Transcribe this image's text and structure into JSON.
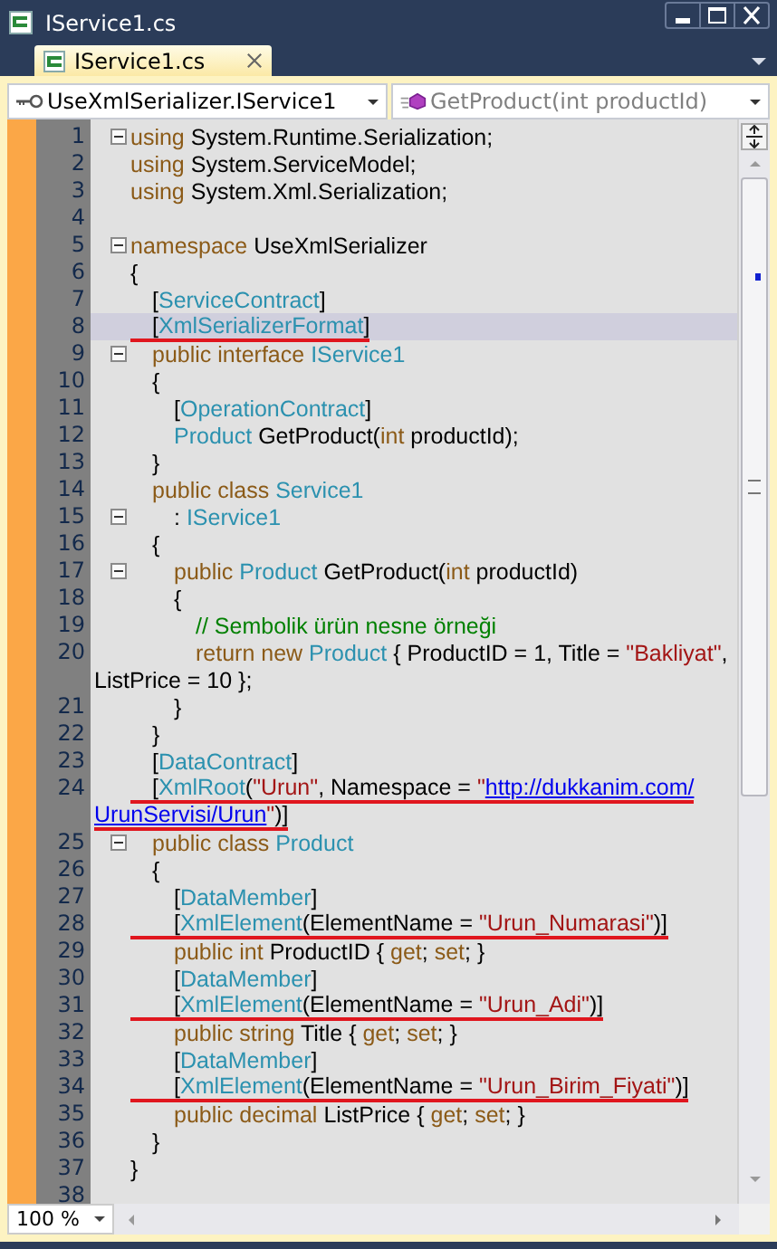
{
  "window": {
    "title": "IService1.cs"
  },
  "tabs": [
    {
      "label": "IService1.cs",
      "selected": true
    }
  ],
  "navigation": {
    "type_combo": "UseXmlSerializer.IService1",
    "member_combo": "GetProduct(int productId)"
  },
  "editor": {
    "lines": [
      {
        "number": "1",
        "fold": true,
        "tokens": [
          {
            "kind": "keyword",
            "text": "using"
          },
          {
            "kind": "plain",
            "text": " System.Runtime.Serialization;"
          }
        ]
      },
      {
        "number": "2",
        "fold": false,
        "tokens": [
          {
            "kind": "keyword",
            "text": "using"
          },
          {
            "kind": "plain",
            "text": " System.ServiceModel;"
          }
        ]
      },
      {
        "number": "3",
        "fold": false,
        "tokens": [
          {
            "kind": "keyword",
            "text": "using"
          },
          {
            "kind": "plain",
            "text": " System.Xml.Serialization;"
          }
        ]
      },
      {
        "number": "4",
        "fold": false
      },
      {
        "number": "5",
        "fold": true,
        "tokens": [
          {
            "kind": "keyword",
            "text": "namespace"
          },
          {
            "kind": "plain",
            "text": " UseXmlSerializer"
          }
        ]
      },
      {
        "number": "6",
        "fold": false,
        "tokens": [
          {
            "kind": "plain",
            "text": "{"
          }
        ]
      },
      {
        "number": "7",
        "fold": false,
        "tokens": [
          {
            "kind": "plain",
            "text": "\t["
          },
          {
            "kind": "type",
            "text": "ServiceContract"
          },
          {
            "kind": "plain",
            "text": "]"
          }
        ]
      },
      {
        "number": "8",
        "fold": false,
        "current": true,
        "underlined": true,
        "tokens": [
          {
            "kind": "plain",
            "text": "\t["
          },
          {
            "kind": "type",
            "text": "XmlSerializerFormat"
          },
          {
            "kind": "plain",
            "text": "]"
          }
        ]
      },
      {
        "number": "9",
        "fold": true,
        "tokens": [
          {
            "kind": "keyword",
            "text": "\tpublic interface "
          },
          {
            "kind": "type",
            "text": "IService1"
          }
        ]
      },
      {
        "number": "10",
        "fold": false,
        "tokens": [
          {
            "kind": "plain",
            "text": "\t{"
          }
        ]
      },
      {
        "number": "11",
        "fold": false,
        "tokens": [
          {
            "kind": "plain",
            "text": "\t\t["
          },
          {
            "kind": "type",
            "text": "OperationContract"
          },
          {
            "kind": "plain",
            "text": "]"
          }
        ]
      },
      {
        "number": "12",
        "fold": false,
        "tokens": [
          {
            "kind": "type",
            "text": "\t\tProduct"
          },
          {
            "kind": "plain",
            "text": " GetProduct("
          },
          {
            "kind": "keyword",
            "text": "int"
          },
          {
            "kind": "plain",
            "text": " productId);"
          }
        ]
      },
      {
        "number": "13",
        "fold": false,
        "tokens": [
          {
            "kind": "plain",
            "text": "\t}"
          }
        ]
      },
      {
        "number": "14",
        "fold": false,
        "tokens": [
          {
            "kind": "keyword",
            "text": "\tpublic class "
          },
          {
            "kind": "type",
            "text": "Service1"
          }
        ]
      },
      {
        "number": "15",
        "fold": true,
        "tokens": [
          {
            "kind": "plain",
            "text": "\t\t: "
          },
          {
            "kind": "type",
            "text": "IService1"
          }
        ]
      },
      {
        "number": "16",
        "fold": false,
        "tokens": [
          {
            "kind": "plain",
            "text": "\t{"
          }
        ]
      },
      {
        "number": "17",
        "fold": true,
        "tokens": [
          {
            "kind": "keyword",
            "text": "\t\tpublic "
          },
          {
            "kind": "type",
            "text": "Product"
          },
          {
            "kind": "plain",
            "text": " GetProduct("
          },
          {
            "kind": "keyword",
            "text": "int"
          },
          {
            "kind": "plain",
            "text": " productId)"
          }
        ]
      },
      {
        "number": "18",
        "fold": false,
        "tokens": [
          {
            "kind": "plain",
            "text": "\t\t{"
          }
        ]
      },
      {
        "number": "19",
        "fold": false,
        "tokens": [
          {
            "kind": "comment",
            "text": "\t\t\t// Sembolik ürün nesne örneği"
          }
        ]
      },
      {
        "number": "20",
        "fold": false,
        "tokens": [
          {
            "kind": "keyword",
            "text": "\t\t\treturn new "
          },
          {
            "kind": "type",
            "text": "Product"
          },
          {
            "kind": "plain",
            "text": " { ProductID = 1, Title = "
          },
          {
            "kind": "string",
            "text": "\"Bakliyat\""
          },
          {
            "kind": "plain",
            "text": ","
          }
        ],
        "continuation": [
          {
            "kind": "plain",
            "text": "ListPrice = 10 };"
          }
        ]
      },
      {
        "number": "21",
        "fold": false,
        "tokens": [
          {
            "kind": "plain",
            "text": "\t\t}"
          }
        ]
      },
      {
        "number": "22",
        "fold": false,
        "tokens": [
          {
            "kind": "plain",
            "text": "\t}"
          }
        ]
      },
      {
        "number": "23",
        "fold": false,
        "tokens": [
          {
            "kind": "plain",
            "text": "\t["
          },
          {
            "kind": "type",
            "text": "DataContract"
          },
          {
            "kind": "plain",
            "text": "]"
          }
        ]
      },
      {
        "number": "24",
        "fold": false,
        "underlined": true,
        "tokens": [
          {
            "kind": "plain",
            "text": "\t["
          },
          {
            "kind": "type",
            "text": "XmlRoot"
          },
          {
            "kind": "plain",
            "text": "("
          },
          {
            "kind": "string",
            "text": "\"Urun\""
          },
          {
            "kind": "plain",
            "text": ", Namespace = "
          },
          {
            "kind": "string",
            "text": "\""
          },
          {
            "kind": "link",
            "text": "http://dukkanim.com/"
          }
        ],
        "continuation": [
          {
            "kind": "link",
            "text": "UrunServisi/Urun"
          },
          {
            "kind": "string",
            "text": "\""
          },
          {
            "kind": "plain",
            "text": ")]"
          }
        ]
      },
      {
        "number": "25",
        "fold": true,
        "tokens": [
          {
            "kind": "keyword",
            "text": "\tpublic class "
          },
          {
            "kind": "type",
            "text": "Product"
          }
        ]
      },
      {
        "number": "26",
        "fold": false,
        "tokens": [
          {
            "kind": "plain",
            "text": "\t{"
          }
        ]
      },
      {
        "number": "27",
        "fold": false,
        "tokens": [
          {
            "kind": "plain",
            "text": "\t\t["
          },
          {
            "kind": "type",
            "text": "DataMember"
          },
          {
            "kind": "plain",
            "text": "]"
          }
        ]
      },
      {
        "number": "28",
        "fold": false,
        "underlined": true,
        "tokens": [
          {
            "kind": "plain",
            "text": "\t\t["
          },
          {
            "kind": "type",
            "text": "XmlElement"
          },
          {
            "kind": "plain",
            "text": "(ElementName = "
          },
          {
            "kind": "string",
            "text": "\"Urun_Numarasi\""
          },
          {
            "kind": "plain",
            "text": ")]"
          }
        ]
      },
      {
        "number": "29",
        "fold": false,
        "tokens": [
          {
            "kind": "keyword",
            "text": "\t\tpublic int "
          },
          {
            "kind": "plain",
            "text": "ProductID { "
          },
          {
            "kind": "keyword",
            "text": "get"
          },
          {
            "kind": "plain",
            "text": "; "
          },
          {
            "kind": "keyword",
            "text": "set"
          },
          {
            "kind": "plain",
            "text": "; }"
          }
        ]
      },
      {
        "number": "30",
        "fold": false,
        "tokens": [
          {
            "kind": "plain",
            "text": "\t\t["
          },
          {
            "kind": "type",
            "text": "DataMember"
          },
          {
            "kind": "plain",
            "text": "]"
          }
        ]
      },
      {
        "number": "31",
        "fold": false,
        "underlined": true,
        "tokens": [
          {
            "kind": "plain",
            "text": "\t\t["
          },
          {
            "kind": "type",
            "text": "XmlElement"
          },
          {
            "kind": "plain",
            "text": "(ElementName = "
          },
          {
            "kind": "string",
            "text": "\"Urun_Adi\""
          },
          {
            "kind": "plain",
            "text": ")]"
          }
        ]
      },
      {
        "number": "32",
        "fold": false,
        "tokens": [
          {
            "kind": "keyword",
            "text": "\t\tpublic string "
          },
          {
            "kind": "plain",
            "text": "Title { "
          },
          {
            "kind": "keyword",
            "text": "get"
          },
          {
            "kind": "plain",
            "text": "; "
          },
          {
            "kind": "keyword",
            "text": "set"
          },
          {
            "kind": "plain",
            "text": "; }"
          }
        ]
      },
      {
        "number": "33",
        "fold": false,
        "tokens": [
          {
            "kind": "plain",
            "text": "\t\t["
          },
          {
            "kind": "type",
            "text": "DataMember"
          },
          {
            "kind": "plain",
            "text": "]"
          }
        ]
      },
      {
        "number": "34",
        "fold": false,
        "underlined": true,
        "tokens": [
          {
            "kind": "plain",
            "text": "\t\t["
          },
          {
            "kind": "type",
            "text": "XmlElement"
          },
          {
            "kind": "plain",
            "text": "(ElementName = "
          },
          {
            "kind": "string",
            "text": "\"Urun_Birim_Fiyati\""
          },
          {
            "kind": "plain",
            "text": ")]"
          }
        ]
      },
      {
        "number": "35",
        "fold": false,
        "tokens": [
          {
            "kind": "keyword",
            "text": "\t\tpublic decimal "
          },
          {
            "kind": "plain",
            "text": "ListPrice { "
          },
          {
            "kind": "keyword",
            "text": "get"
          },
          {
            "kind": "plain",
            "text": "; "
          },
          {
            "kind": "keyword",
            "text": "set"
          },
          {
            "kind": "plain",
            "text": "; }"
          }
        ]
      },
      {
        "number": "36",
        "fold": false,
        "tokens": [
          {
            "kind": "plain",
            "text": "\t}"
          }
        ]
      },
      {
        "number": "37",
        "fold": false,
        "tokens": [
          {
            "kind": "plain",
            "text": "}"
          }
        ]
      },
      {
        "number": "38",
        "fold": false
      }
    ]
  },
  "zoom": {
    "value": "100 %"
  }
}
